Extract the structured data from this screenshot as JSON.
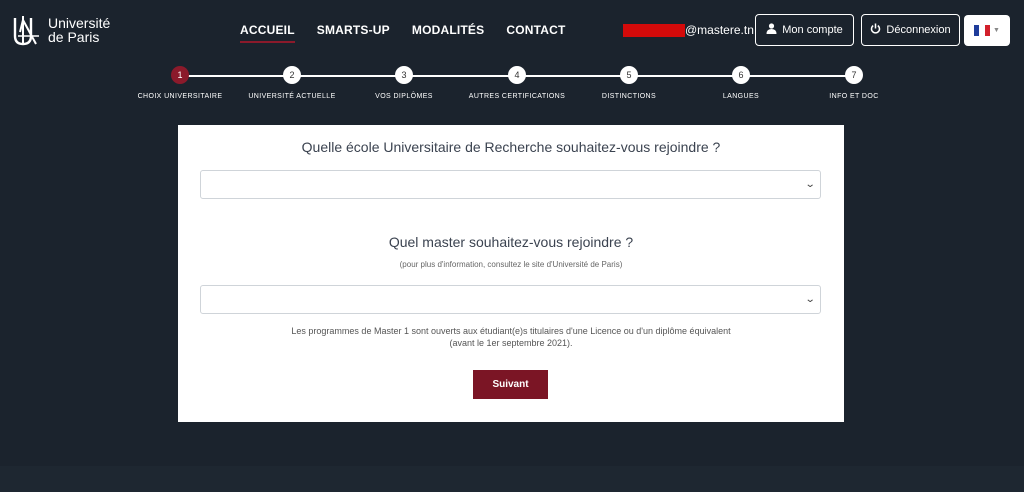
{
  "header": {
    "logo_line1": "Université",
    "logo_line2": "de Paris",
    "nav": [
      {
        "label": "ACCUEIL",
        "active": true
      },
      {
        "label": "SMARTS-UP"
      },
      {
        "label": "MODALITÉS"
      },
      {
        "label": "CONTACT"
      }
    ],
    "email_domain": "@mastere.tn",
    "account_label": "Mon compte",
    "logout_label": "Déconnexion",
    "language_flag": "fr-flag-icon"
  },
  "stepper": {
    "steps": [
      {
        "num": "1",
        "label": "CHOIX UNIVERSITAIRE",
        "active": true
      },
      {
        "num": "2",
        "label": "UNIVERSITÉ ACTUELLE"
      },
      {
        "num": "3",
        "label": "VOS DIPLÔMES"
      },
      {
        "num": "4",
        "label": "AUTRES CERTIFICATIONS"
      },
      {
        "num": "5",
        "label": "DISTINCTIONS"
      },
      {
        "num": "6",
        "label": "LANGUES"
      },
      {
        "num": "7",
        "label": "INFO ET DOC"
      }
    ]
  },
  "form": {
    "question1": "Quelle école Universitaire de Recherche souhaitez-vous rejoindre ?",
    "select1_value": "",
    "question2": "Quel master souhaitez-vous rejoindre ?",
    "hint": "(pour plus d'information, consultez le site d'Université de Paris)",
    "select2_value": "",
    "note_line1": "Les programmes de Master 1 sont ouverts aux étudiant(e)s titulaires d'une Licence ou d'un diplôme équivalent",
    "note_line2": "(avant le 1er septembre 2021).",
    "submit_label": "Suivant"
  },
  "colors": {
    "background": "#1b232d",
    "accent": "#8b1a2b",
    "button": "#7b1525"
  }
}
